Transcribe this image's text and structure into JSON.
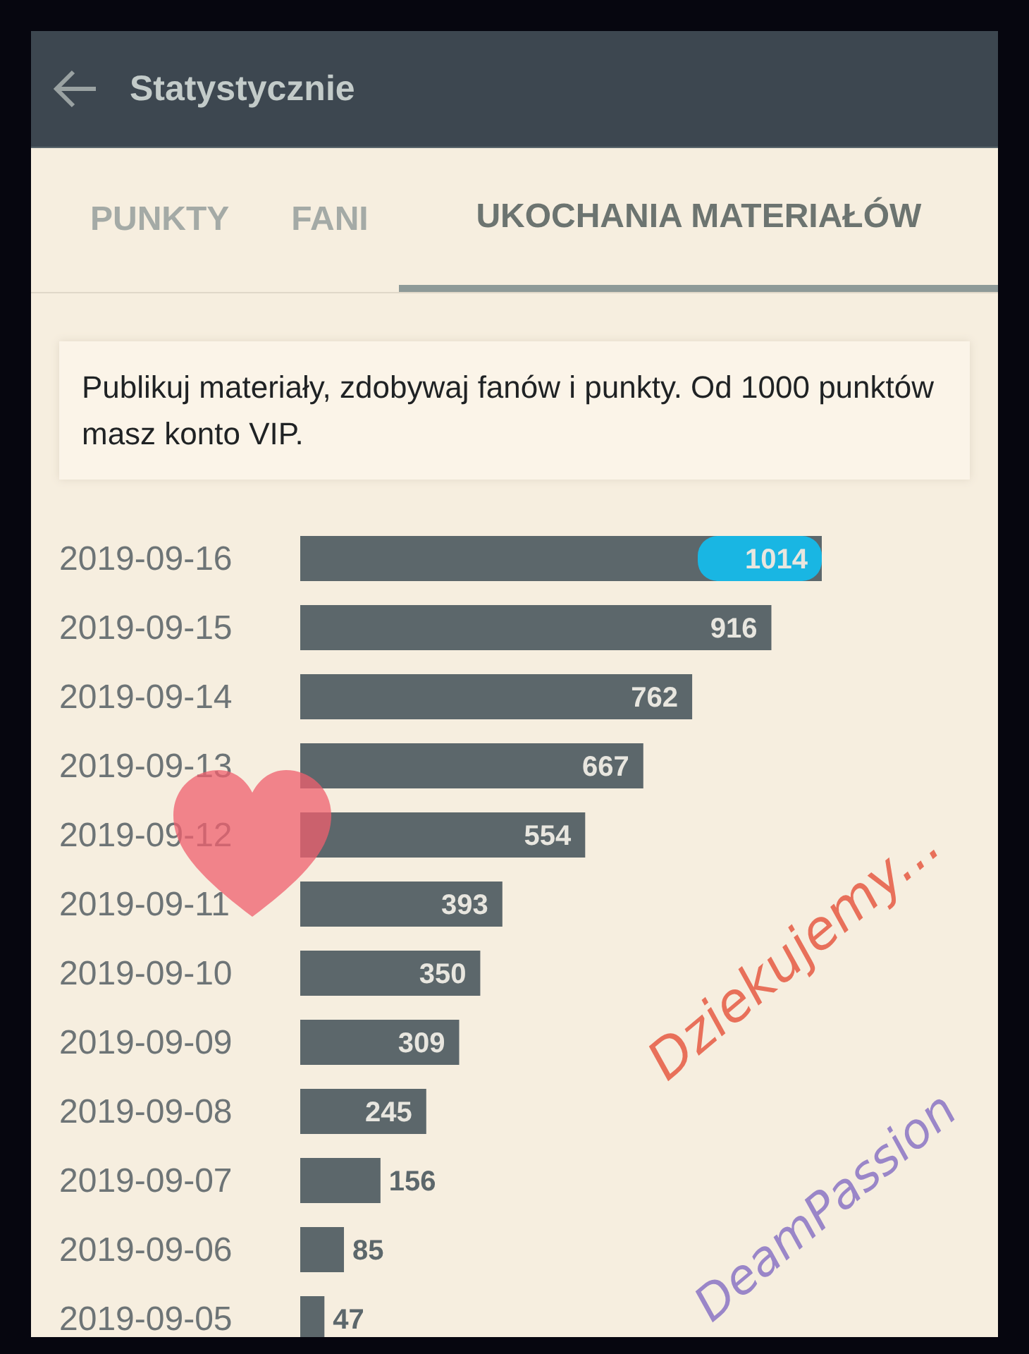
{
  "app_bar": {
    "title": "Statystycznie"
  },
  "tabs": [
    {
      "label": "PUNKTY",
      "selected": false
    },
    {
      "label": "FANI",
      "selected": false
    },
    {
      "label": "UKOCHANIA MATERIAŁÓW",
      "selected": true
    }
  ],
  "info": "Publikuj materiały, zdobywaj fanów i punkty. Od 1000 punktów masz konto VIP.",
  "chart": {
    "chart_data": {
      "type": "bar",
      "orientation": "horizontal",
      "data_labels": true,
      "categories": [
        "2019-09-16",
        "2019-09-15",
        "2019-09-14",
        "2019-09-13",
        "2019-09-12",
        "2019-09-11",
        "2019-09-10",
        "2019-09-09",
        "2019-09-08",
        "2019-09-07",
        "2019-09-06",
        "2019-09-05"
      ],
      "series": [
        {
          "color": "#5c676b",
          "values": [
            1014,
            916,
            762,
            667,
            554,
            393,
            350,
            309,
            245,
            156,
            85,
            47
          ]
        }
      ]
    },
    "highlight_max": true
  },
  "overlay": {
    "lines": [
      {
        "text": "Dziekujemy...",
        "color": "#e8705a"
      },
      {
        "text": "DeamPassion",
        "color": "#9a86c8"
      }
    ]
  }
}
